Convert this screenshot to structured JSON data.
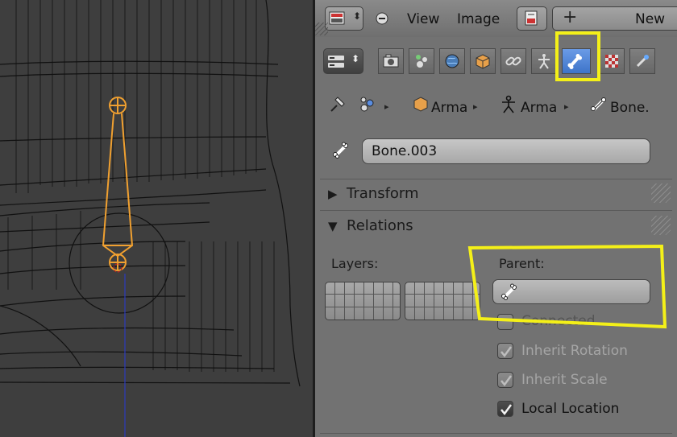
{
  "header": {
    "menu_view": "View",
    "menu_image": "Image",
    "new_label": "New"
  },
  "tabs": [
    "render-icon",
    "scene-icon",
    "world-icon",
    "object-icon",
    "constraints-icon",
    "armature-data-icon",
    "bone-icon",
    "material-icon",
    "bone-constraint-icon"
  ],
  "active_tab": "bone-icon",
  "breadcrumb": {
    "items": [
      "Arma",
      "Arma",
      "Bone."
    ]
  },
  "bone_name": "Bone.003",
  "sections": {
    "transform": "Transform",
    "relations": "Relations"
  },
  "relations": {
    "layers_label": "Layers:",
    "parent_label": "Parent:",
    "parent_value": "",
    "options": [
      {
        "label": "Connected",
        "checked": false
      },
      {
        "label": "Inherit Rotation",
        "checked": true
      },
      {
        "label": "Inherit Scale",
        "checked": true
      },
      {
        "label": "Local Location",
        "checked": true
      }
    ]
  },
  "colors": {
    "highlight": "#f4f018",
    "bone_selected": "#f0a030",
    "active_tab": "#4a82d8"
  }
}
